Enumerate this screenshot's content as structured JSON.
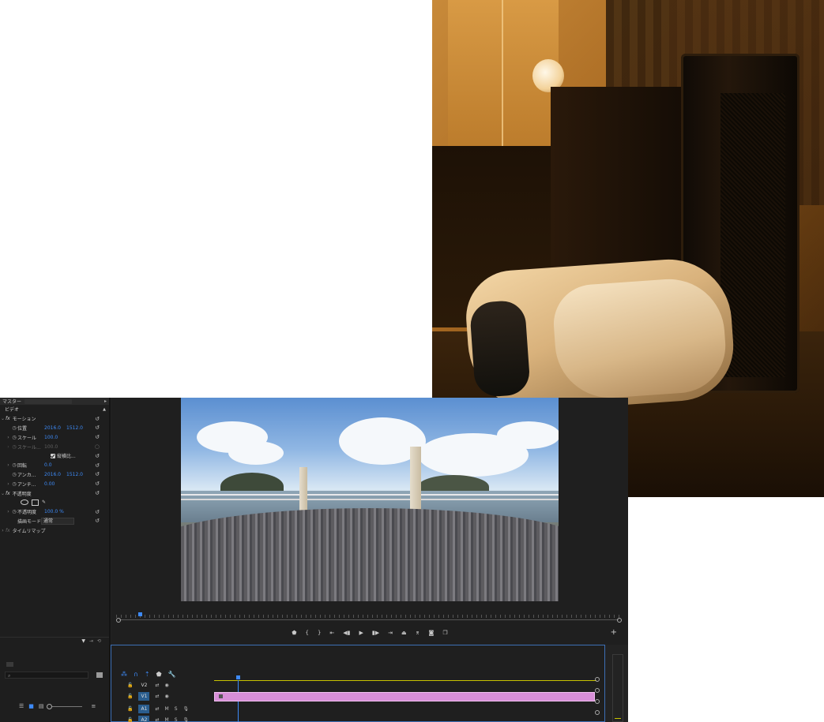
{
  "effect_controls": {
    "master_label": "マスター",
    "video_section": "ビデオ",
    "motion": "モーション",
    "position_label": "位置",
    "position_x": "2016.0",
    "position_y": "1512.0",
    "scale_label": "スケール",
    "scale_value": "100.0",
    "scale_width_label": "スケール...",
    "scale_width_value": "100.0",
    "uniform_label": "縦横比...",
    "rotation_label": "回転",
    "rotation_value": "0.0",
    "anchor_label": "アンカ...",
    "anchor_x": "2016.0",
    "anchor_y": "1512.0",
    "antiflicker_label": "アンチ...",
    "antiflicker_value": "0.00",
    "opacity": "不透明度",
    "opacity_label": "不透明度",
    "opacity_value": "100.0 %",
    "blend_label": "描画モード",
    "blend_value": "通常",
    "time_remap": "タイムリマップ"
  },
  "timeline": {
    "tracks": [
      {
        "name": "V2",
        "type": "video",
        "targeted": false
      },
      {
        "name": "V1",
        "type": "video",
        "targeted": true
      },
      {
        "name": "A1",
        "type": "audio",
        "targeted": true
      },
      {
        "name": "A2",
        "type": "audio",
        "targeted": true
      }
    ],
    "audio_mute": "M",
    "audio_solo": "S"
  },
  "colors": {
    "accent": "#3d8af7",
    "clip": "#d88fd8",
    "panel": "#1e1e1e"
  }
}
